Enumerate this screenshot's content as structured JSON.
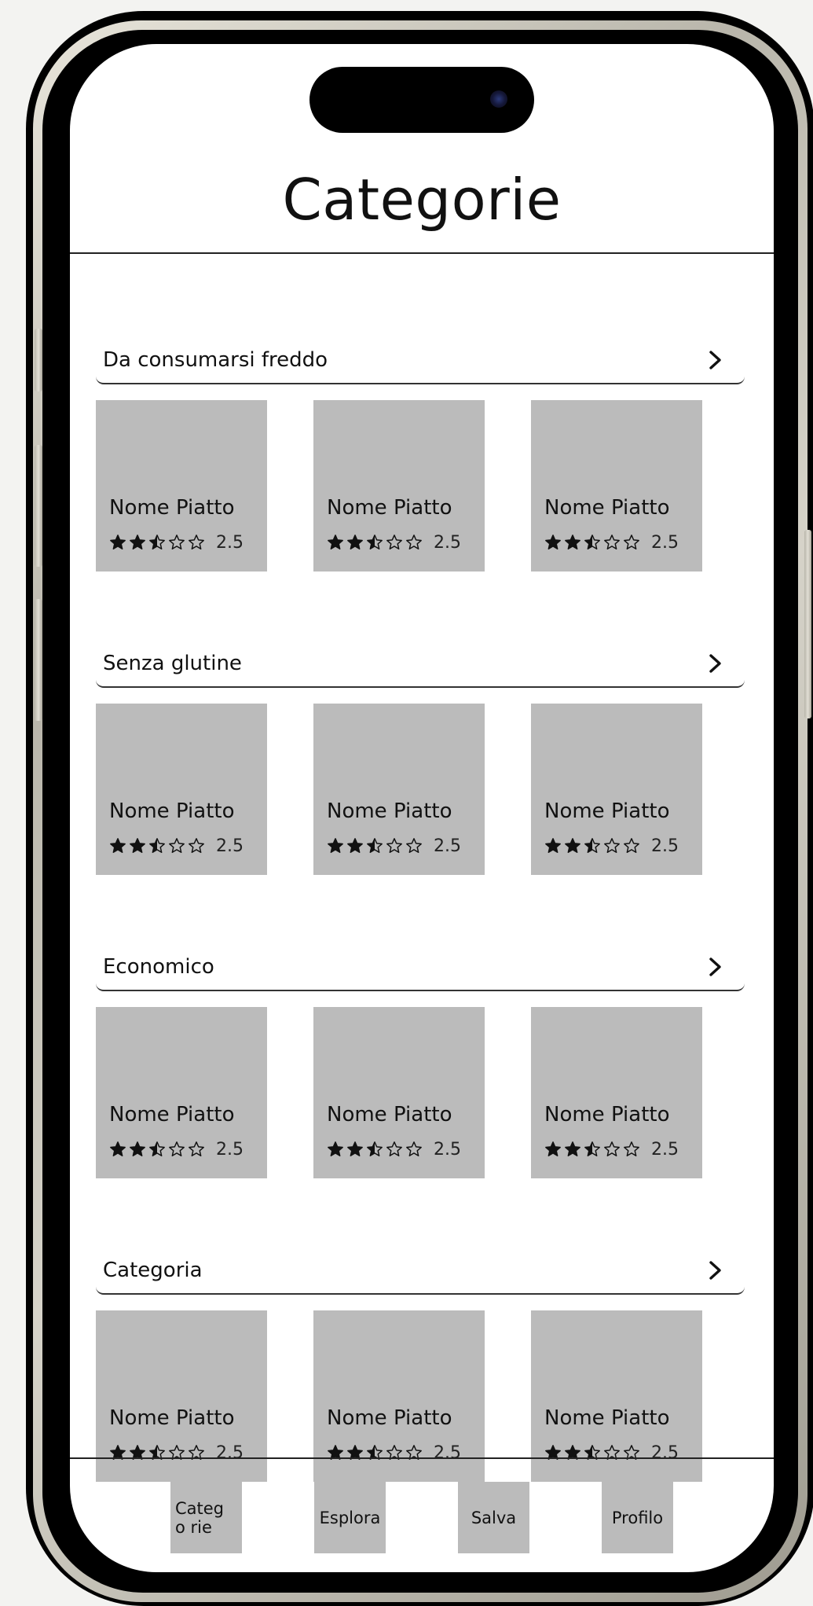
{
  "header": {
    "title": "Categorie"
  },
  "sections": [
    {
      "title": "Da consumarsi freddo",
      "cards": [
        {
          "name": "Nome Piatto",
          "rating": "2.5"
        },
        {
          "name": "Nome Piatto",
          "rating": "2.5"
        },
        {
          "name": "Nome Piatto",
          "rating": "2.5"
        }
      ]
    },
    {
      "title": "Senza glutine",
      "cards": [
        {
          "name": "Nome Piatto",
          "rating": "2.5"
        },
        {
          "name": "Nome Piatto",
          "rating": "2.5"
        },
        {
          "name": "Nome Piatto",
          "rating": "2.5"
        }
      ]
    },
    {
      "title": "Economico",
      "cards": [
        {
          "name": "Nome Piatto",
          "rating": "2.5"
        },
        {
          "name": "Nome Piatto",
          "rating": "2.5"
        },
        {
          "name": "Nome Piatto",
          "rating": "2.5"
        }
      ]
    },
    {
      "title": "Categoria",
      "cards": [
        {
          "name": "Nome Piatto",
          "rating": "2.5"
        },
        {
          "name": "Nome Piatto",
          "rating": "2.5"
        },
        {
          "name": "Nome Piatto",
          "rating": "2.5"
        }
      ]
    }
  ],
  "tabbar": {
    "tabs": [
      {
        "label": "Catego rie"
      },
      {
        "label": "Esplora"
      },
      {
        "label": "Salva"
      },
      {
        "label": "Profilo"
      }
    ]
  },
  "colors": {
    "card_background": "#bbbbbb",
    "text": "#111111",
    "screen_background": "#ffffff"
  }
}
